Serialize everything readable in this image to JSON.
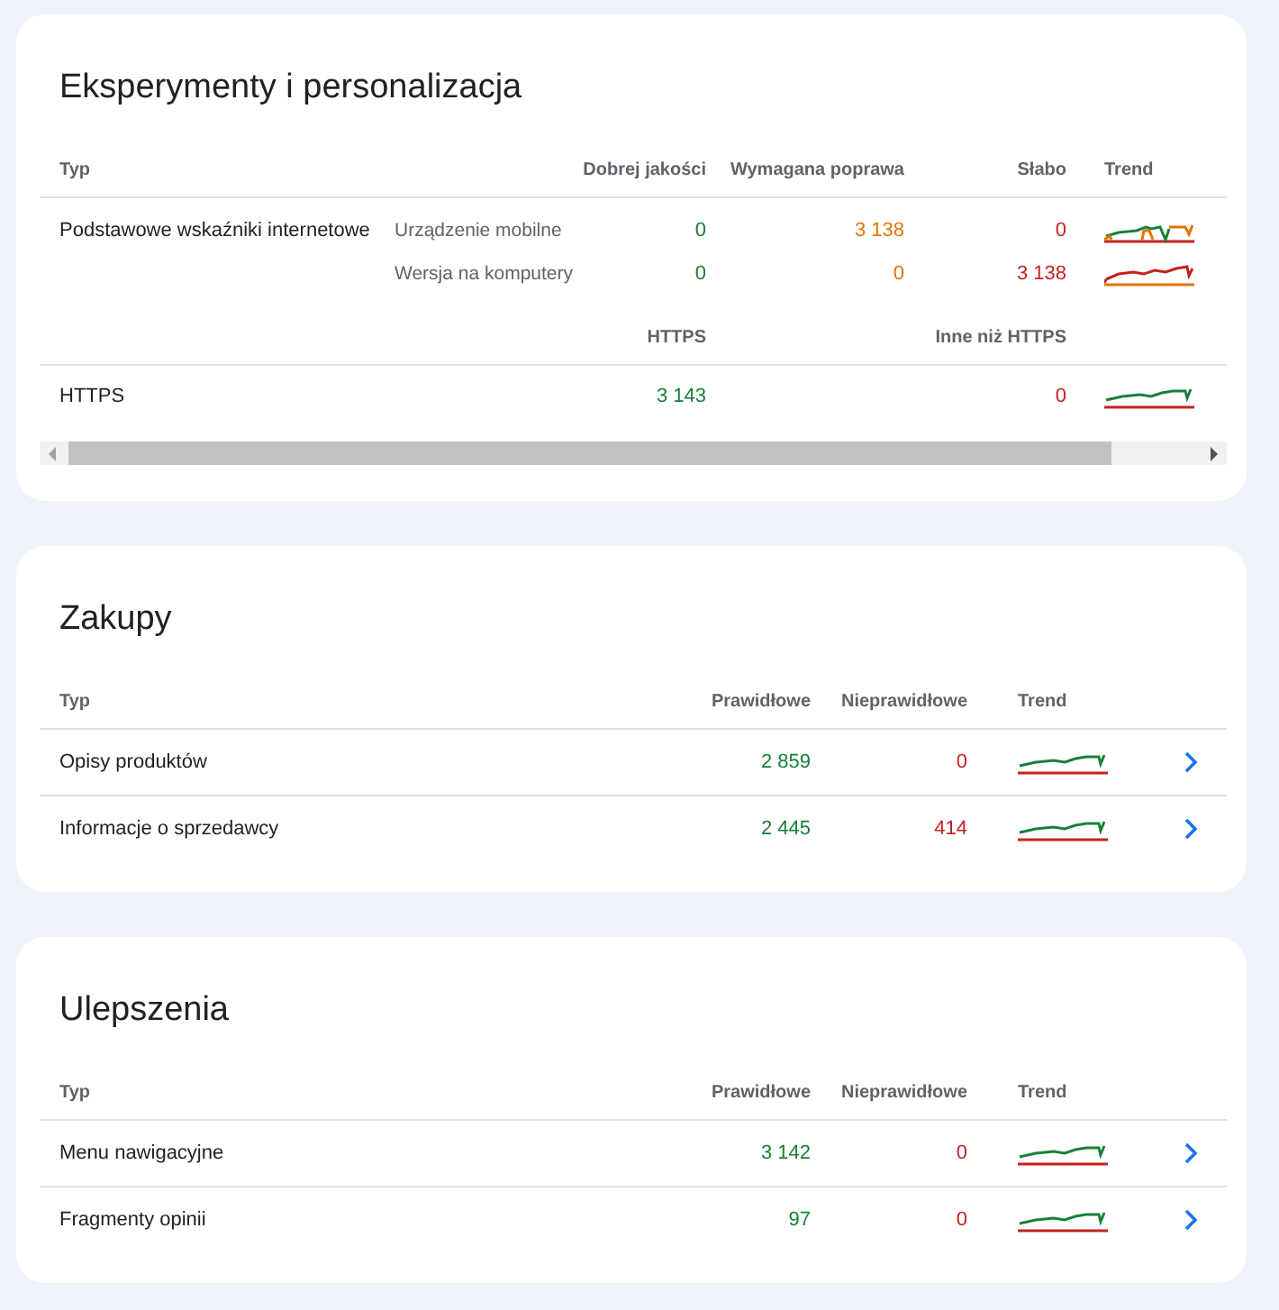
{
  "sections": [
    {
      "kind": "vitals",
      "title": "Eksperymenty i personalizacja",
      "columns": [
        "Typ",
        "Dobrej jakości",
        "Wymagana poprawa",
        "Słabo",
        "Trend"
      ],
      "rows": [
        {
          "label": "Podstawowe wskaźniki internetowe",
          "device": "Urządzenie mobilne",
          "good": "0",
          "needs_improvement": "3 138",
          "poor": "0"
        },
        {
          "device": "Wersja na komputery",
          "good": "0",
          "needs_improvement": "0",
          "poor": "3 138"
        }
      ],
      "https_columns": [
        "HTTPS",
        "Inne niż HTTPS"
      ],
      "https_rows": [
        {
          "label": "HTTPS",
          "https": "3 143",
          "non_https": "0"
        }
      ]
    },
    {
      "kind": "list",
      "title": "Zakupy",
      "columns": [
        "Typ",
        "Prawidłowe",
        "Nieprawidłowe",
        "Trend"
      ],
      "rows": [
        {
          "label": "Opisy produktów",
          "valid": "2 859",
          "invalid": "0"
        },
        {
          "label": "Informacje o sprzedawcy",
          "valid": "2 445",
          "invalid": "414"
        }
      ]
    },
    {
      "kind": "list",
      "title": "Ulepszenia",
      "columns": [
        "Typ",
        "Prawidłowe",
        "Nieprawidłowe",
        "Trend"
      ],
      "rows": [
        {
          "label": "Menu nawigacyjne",
          "valid": "3 142",
          "invalid": "0"
        },
        {
          "label": "Fragmenty opinii",
          "valid": "97",
          "invalid": "0"
        }
      ]
    }
  ]
}
